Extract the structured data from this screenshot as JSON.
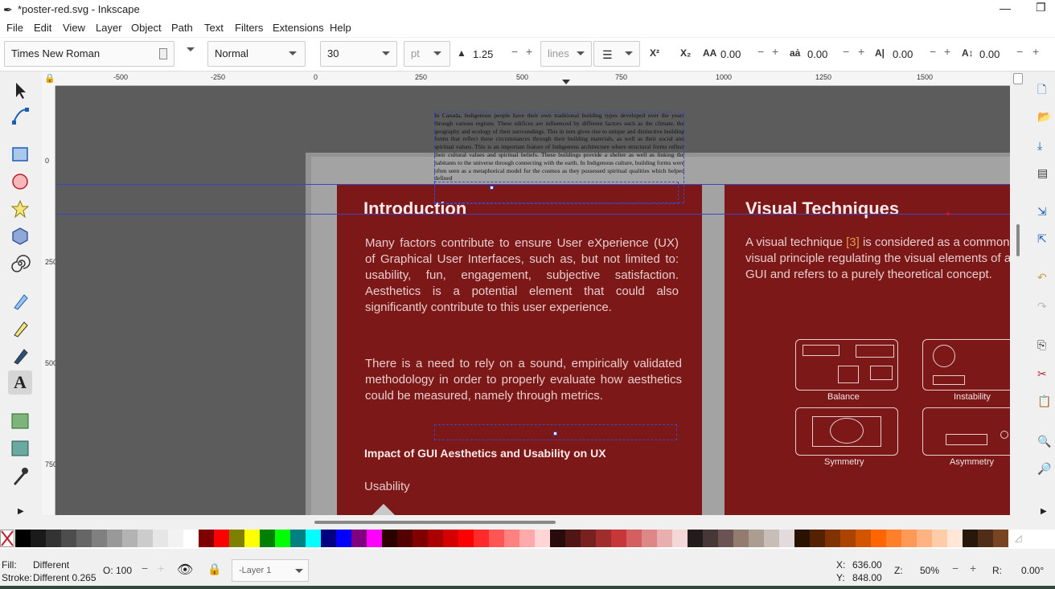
{
  "window": {
    "title": "*poster-red.svg - Inkscape"
  },
  "menu": [
    "File",
    "Edit",
    "View",
    "Layer",
    "Object",
    "Path",
    "Text",
    "Filters",
    "Extensions",
    "Help"
  ],
  "text_toolbar": {
    "font_family": "Times New Roman",
    "font_style": "Normal",
    "font_size": "30",
    "unit": "pt",
    "line_height": "1.25",
    "line_unit": "lines",
    "letter_spacing": "0.00",
    "word_spacing": "0.00",
    "kerning_h": "0.00",
    "kerning_v": "0.00"
  },
  "ruler": {
    "h_labels": [
      "-500",
      "-250",
      "0",
      "250",
      "500",
      "750",
      "1000",
      "1250",
      "1500"
    ],
    "v_labels": [
      "0",
      "250",
      "500",
      "750"
    ]
  },
  "canvas": {
    "panel_left": {
      "title": "Introduction",
      "para1": "Many factors contribute to ensure User eXperience (UX) of Graphical User Interfaces, such as, but not limited to: usability, fun, engagement, subjective satisfaction. Aesthetics is a potential element that could also significantly contribute to this user experience.",
      "para2": "There is a need to rely on a sound, empirically validated methodology in order to properly evaluate how aesthetics could be measured, namely through metrics.",
      "subheading": "Impact of GUI Aesthetics and Usability on UX",
      "usability": "Usability"
    },
    "panel_right": {
      "title": "Visual Techniques",
      "para_parts": [
        "A visual technique ",
        "[3]",
        " is considered as a common visual principle regulating the visual elements of a GUI and refers to a purely theoretical concept."
      ],
      "figures": [
        "Balance",
        "Instability",
        "Symmetry",
        "Asymmetry"
      ]
    },
    "overlay_text": "In Canada, Indigenous people have their own traditional building types developed over the years through various regions. These edifices are influenced by different factors such as the climate, the geography and ecology of their surroundings. This in turn gives rise to unique and distinctive building forms that reflect these circumstances through their building materials, as well as their social and spiritual values. This is an important feature of Indigenous architecture where structural forms reflect their cultural values and spiritual beliefs. These buildings provide a shelter as well as linking the habitants to the universe through connecting with the earth. In Indigenous culture, building forms were often seen as a metaphorical model for the cosmos as they possessed spiritual qualities which helped defined"
  },
  "status": {
    "fill_label": "Fill:",
    "fill_value": "Different",
    "stroke_label": "Stroke:",
    "stroke_value": "Different 0.265",
    "opacity_label": "O:",
    "opacity_value": "100",
    "layer": "-Layer 1",
    "x_label": "X:",
    "x_value": "636.00",
    "y_label": "Y:",
    "y_value": "848.00",
    "zoom_label": "Z:",
    "zoom_value": "50%",
    "rotation_label": "R:",
    "rotation_value": "0.00°"
  },
  "palette": [
    "#000000",
    "#1a1a1a",
    "#333333",
    "#4d4d4d",
    "#666666",
    "#808080",
    "#999999",
    "#b3b3b3",
    "#cccccc",
    "#e6e6e6",
    "#f2f2f2",
    "#ffffff",
    "#800000",
    "#ff0000",
    "#808000",
    "#ffff00",
    "#008000",
    "#00ff00",
    "#008080",
    "#00ffff",
    "#000080",
    "#0000ff",
    "#800080",
    "#ff00ff",
    "#2b0000",
    "#550000",
    "#800000",
    "#aa0000",
    "#d40000",
    "#ff0000",
    "#ff2a2a",
    "#ff5555",
    "#ff8080",
    "#ffaaaa",
    "#ffd5d5",
    "#280b0b",
    "#501616",
    "#782121",
    "#a02c2c",
    "#c83737",
    "#d35f5f",
    "#de8787",
    "#e9afaf",
    "#f4d7d7",
    "#241c1c",
    "#483737",
    "#6c5353",
    "#917c6f",
    "#ac9d93",
    "#c8beb7",
    "#e3dbdb",
    "#2b1100",
    "#552200",
    "#803300",
    "#aa4400",
    "#d45500",
    "#ff6600",
    "#ff7f2a",
    "#ff9955",
    "#ffb380",
    "#ffccaa",
    "#ffe6d5",
    "#28170b",
    "#502d16",
    "#784421"
  ]
}
